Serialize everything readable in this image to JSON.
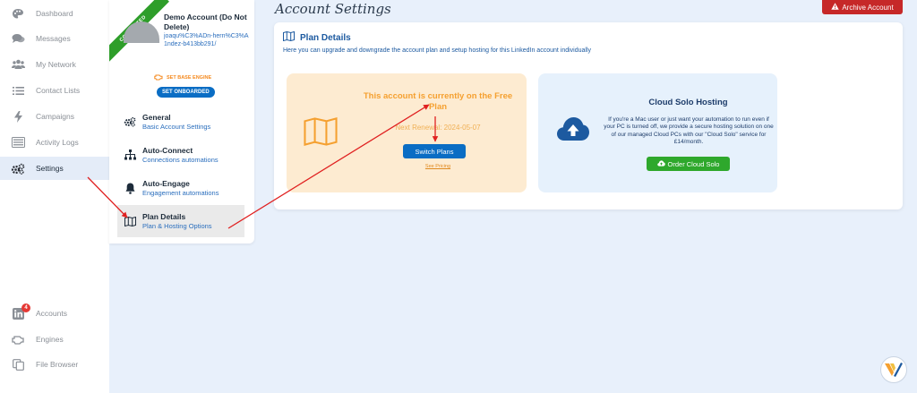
{
  "sidebar": {
    "items": [
      {
        "label": "Dashboard",
        "icon": "palette-icon"
      },
      {
        "label": "Messages",
        "icon": "chat-bubbles-icon"
      },
      {
        "label": "My Network",
        "icon": "users-icon"
      },
      {
        "label": "Contact Lists",
        "icon": "list-icon"
      },
      {
        "label": "Campaigns",
        "icon": "bolt-icon"
      },
      {
        "label": "Activity Logs",
        "icon": "log-list-icon"
      },
      {
        "label": "Settings",
        "icon": "cogs-icon"
      }
    ],
    "bottom_items": [
      {
        "label": "Accounts",
        "icon": "linkedin-icon",
        "badge": "4"
      },
      {
        "label": "Engines",
        "icon": "engine-icon"
      },
      {
        "label": "File Browser",
        "icon": "file-browser-icon"
      }
    ]
  },
  "account": {
    "ribbon": "CONNECTED",
    "name": "Demo Account (Do Not Delete)",
    "slug": "joaqu%C3%ADn-hern%C3%A1ndez-b413bb291/",
    "set_engine": "SET BASE ENGINE",
    "onboarded": "SET ONBOARDED"
  },
  "settings_menu": [
    {
      "title": "General",
      "subtitle": "Basic Account Settings",
      "icon": "cogs-icon"
    },
    {
      "title": "Auto-Connect",
      "subtitle": "Connections automations",
      "icon": "network-icon"
    },
    {
      "title": "Auto-Engage",
      "subtitle": "Engagement automations",
      "icon": "bell-icon"
    },
    {
      "title": "Plan Details",
      "subtitle": "Plan & Hosting Options",
      "icon": "map-icon"
    }
  ],
  "header": {
    "title": "Account Settings",
    "archive_label": "Archive Account"
  },
  "plan": {
    "heading": "Plan Details",
    "description": "Here you can upgrade and downgrade the account plan and setup hosting for this LinkedIn account individually",
    "free_headline": "This account is currently on the Free Plan",
    "renewal": "Next Renewal: 2024-05-07",
    "switch_label": "Switch Plans",
    "pricing_link": "See Pricing"
  },
  "cloud": {
    "title": "Cloud Solo Hosting",
    "description": "If you're a Mac user or just want your automation to run even if your PC is turned off, we provide a secure hosting solution on one of our managed Cloud PCs with our \"Cloud Solo\" service for £14/month.",
    "order_label": "Order Cloud Solo"
  },
  "colors": {
    "accent_blue": "#0a6dc4",
    "archive_red": "#c62828",
    "connected_green": "#2e9e2a",
    "order_green": "#2ea82c",
    "free_orange": "#f5a030",
    "annotation_red": "#e02020"
  }
}
